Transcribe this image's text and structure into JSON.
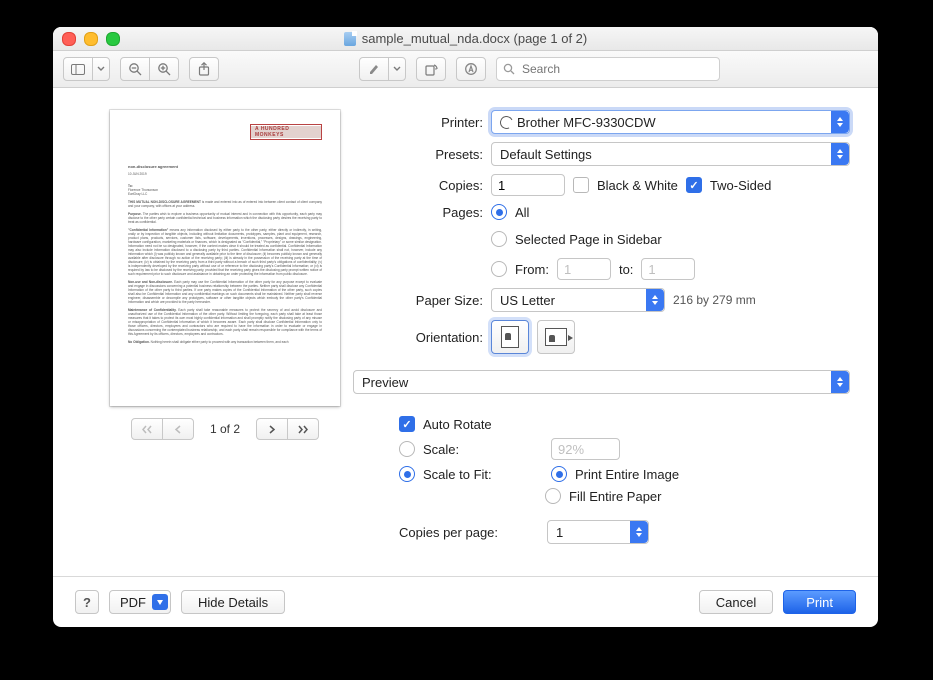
{
  "window": {
    "title": "sample_mutual_nda.docx (page 1 of 2)"
  },
  "toolbar": {
    "search_placeholder": "Search"
  },
  "preview": {
    "pager_label": "1 of 2",
    "doc_heading": "non-disclosure agreement",
    "doc_date": "10 JUN 2019",
    "doc_logo": "A HUNDRED MONKEYS",
    "to_label": "To:",
    "to_line1": "Florence Thorsonson",
    "to_line2": "EarlGray LLC",
    "intro_bold": "THIS MUTUAL NON-DISCLOSURE AGREEMENT",
    "intro_rest": " is made and entered into as of entered into between client contact of client company and your company, with offices at your address.",
    "p1_head": "Purpose.",
    "p1": " The parties wish to explore a business opportunity of mutual interest and in connection with this opportunity, each party may disclose to the other party certain confidential technical and business information which the disclosing party desires the receiving party to treat as confidential.",
    "p2_head": "\"Confidential Information\"",
    "p2": " means any information disclosed by either party to the other party, either directly or indirectly, in writing, orally or by inspection of tangible objects, including without limitation documents, prototypes, samples, plant and equipment, research, product plans, products, services, customer lists, software, developments, inventions, processes, designs, drawings, engineering, hardware configuration, marketing materials or finances, which is designated as \"Confidential,\" \"Proprietary\" or some similar designation. Information need not be so designated, however, if the context makes clear it should be treated as confidential. Confidential Information may also include information disclosed to a disclosing party by third parties. Confidential Information shall not, however, include any information which (i) was publicly known and generally available prior to the time of disclosure; (ii) becomes publicly known and generally available after disclosure through no action of the receiving party; (iii) is already in the possession of the receiving party at the time of disclosure; (iv) is obtained by the receiving party from a third party without a breach of such third party's obligations of confidentiality; (v) is independently developed by the receiving party without use of or reference to the disclosing party's Confidential Information; or (vi) is required by law to be disclosed by the receiving party, provided that the receiving party gives the disclosing party prompt written notice of such requirement prior to such disclosure and assistance in obtaining an order protecting the information from public disclosure.",
    "p3_head": "Non-use and Non-disclosure.",
    "p3": " Each party may use the Confidential Information of the other party for any purpose except to evaluate and engage in discussions concerning a potential business relationship between the parties. Neither party shall disclose any Confidential Information of the other party to third parties. If one party makes copies of the Confidential Information of the other party, such copies shall also be Confidential Information and any confidential markings on such documents shall be maintained. Neither party shall reverse engineer, disassemble or decompile any prototypes, software or other tangible objects which embody the other party's Confidential Information and which are provided to the party hereunder.",
    "p4_head": "Maintenance of Confidentiality.",
    "p4": " Each party shall take reasonable measures to protect the secrecy of and avoid disclosure and unauthorized use of the Confidential Information of the other party. Without limiting the foregoing, each party shall take at least those measures that it takes to protect its own most highly confidential information and shall promptly notify the disclosing party of any misuse or misappropriation of Confidential Information of which it becomes aware. Each party shall disclose Confidential Information only to those officers, directors, employees and contractors who are required to have the information in order to evaluate or engage in discussions concerning the contemplated business relationship, and each party shall remain responsible for compliance with the terms of this Agreement by its officers, directors, employees and contractors.",
    "p5_head": "No Obligation.",
    "p5": " Nothing herein shall obligate either party to proceed with any transaction between them, and each"
  },
  "form": {
    "printer_label": "Printer:",
    "printer_value": "Brother MFC-9330CDW",
    "presets_label": "Presets:",
    "presets_value": "Default Settings",
    "copies_label": "Copies:",
    "copies_value": "1",
    "bw_label": "Black & White",
    "twosided_label": "Two-Sided",
    "pages_label": "Pages:",
    "pages_all": "All",
    "pages_selected": "Selected Page in Sidebar",
    "pages_from": "From:",
    "pages_from_val": "1",
    "pages_to": "to:",
    "pages_to_val": "1",
    "papersize_label": "Paper Size:",
    "papersize_value": "US Letter",
    "papersize_dim": "216 by 279 mm",
    "orientation_label": "Orientation:",
    "module_value": "Preview",
    "auto_rotate": "Auto Rotate",
    "scale_label": "Scale:",
    "scale_value": "92%",
    "scale_fit": "Scale to Fit:",
    "print_entire": "Print Entire Image",
    "fill_entire": "Fill Entire Paper",
    "cpp_label": "Copies per page:",
    "cpp_value": "1"
  },
  "footer": {
    "help": "?",
    "pdf": "PDF",
    "hide_details": "Hide Details",
    "cancel": "Cancel",
    "print": "Print"
  }
}
